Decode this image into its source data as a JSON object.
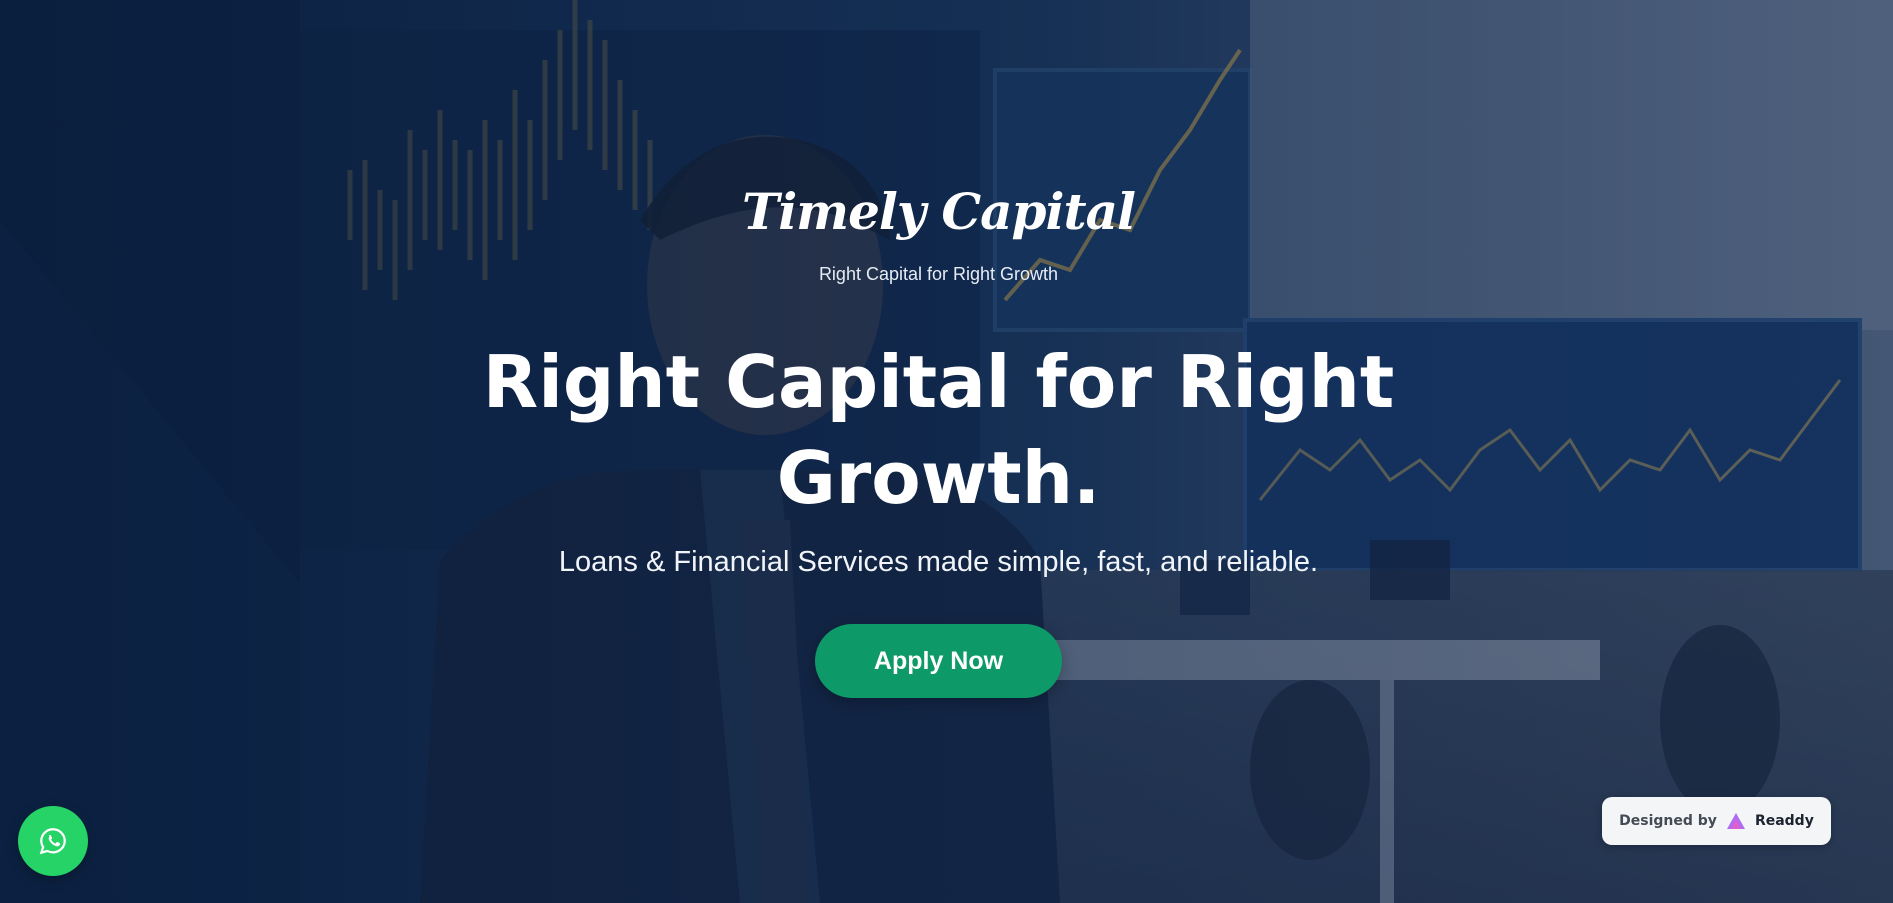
{
  "brand": {
    "name": "Timely Capital",
    "tagline": "Right Capital for Right Growth"
  },
  "hero": {
    "headline": "Right Capital for Right Growth.",
    "subheadline": "Loans & Financial Services made simple, fast, and reliable.",
    "cta_label": "Apply Now",
    "background_image_icon": "businessman-office-stock-charts-photo"
  },
  "whatsapp": {
    "icon": "whatsapp-icon",
    "color": "#25d366"
  },
  "badge": {
    "designed_by_label": "Designed by",
    "logo_icon": "readdy-logo-icon",
    "brand_name": "Readdy"
  },
  "colors": {
    "accent": "#0e9968",
    "overlay": "#0f2a4d",
    "text": "#ffffff"
  }
}
